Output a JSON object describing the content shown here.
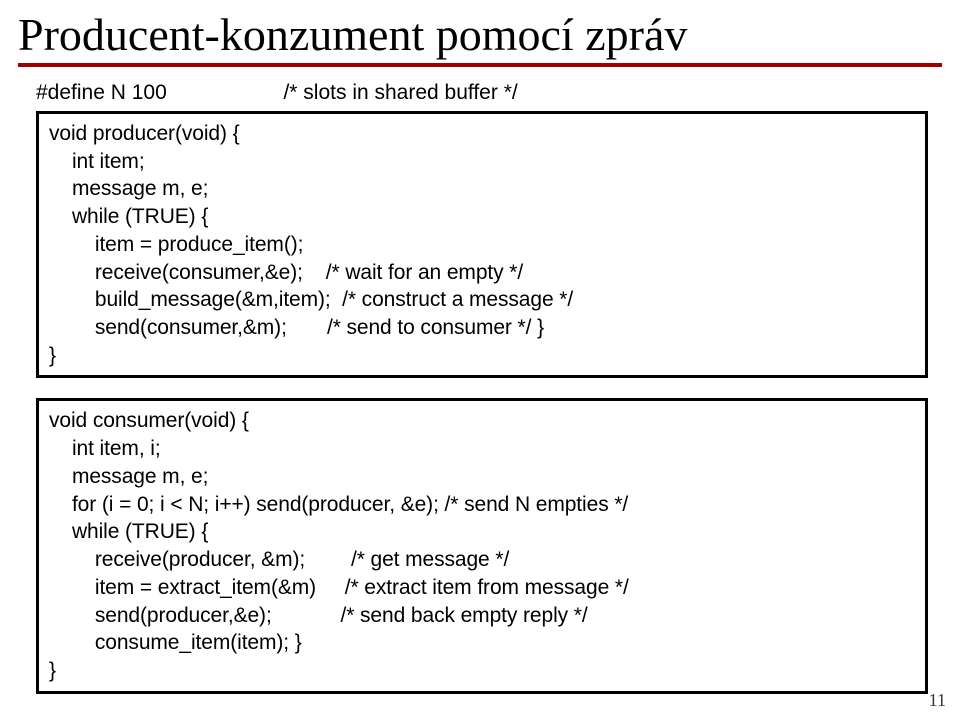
{
  "title": "Producent-konzument pomocí zpráv",
  "pagenum": "11",
  "define_line": "#define N 100                    /* slots in shared buffer */",
  "producer_code": "void producer(void) {\n    int item;\n    message m, e;\n    while (TRUE) {\n        item = produce_item();\n        receive(consumer,&e);    /* wait for an empty */\n        build_message(&m,item);  /* construct a message */\n        send(consumer,&m);       /* send to consumer */ }\n}",
  "consumer_code": "void consumer(void) {\n    int item, i;\n    message m, e;\n    for (i = 0; i < N; i++) send(producer, &e); /* send N empties */\n    while (TRUE) {\n        receive(producer, &m);        /* get message */\n        item = extract_item(&m)     /* extract item from message */\n        send(producer,&e);            /* send back empty reply */\n        consume_item(item); }\n}"
}
